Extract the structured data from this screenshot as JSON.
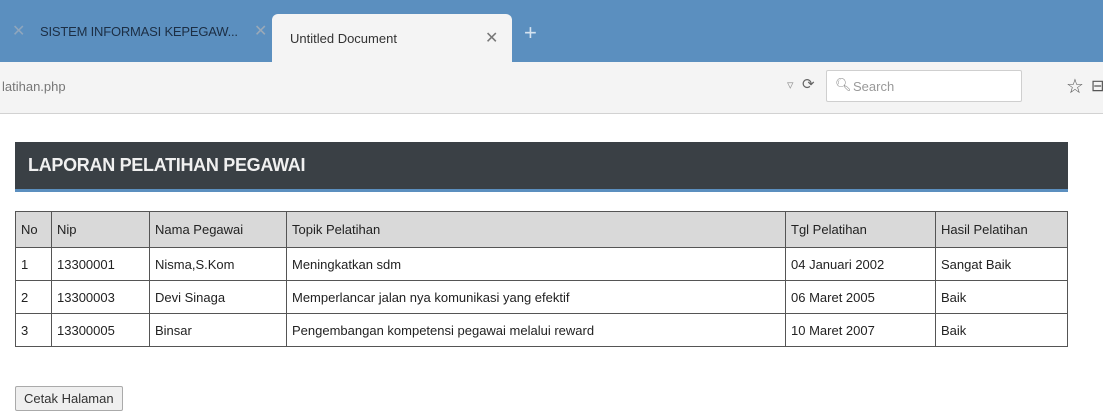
{
  "browser": {
    "tabs": [
      {
        "title": "SISTEM INFORMASI KEPEGAW...",
        "active": false
      },
      {
        "title": "Untitled Document",
        "active": true
      }
    ],
    "new_tab_icon": "plus-icon",
    "url": "latihan.php",
    "search_placeholder": "Search"
  },
  "page": {
    "title": "LAPORAN PELATIHAN PEGAWAI",
    "header_color": "#3a4045",
    "accent_color": "#5b8fbf",
    "table": {
      "columns": [
        "No",
        "Nip",
        "Nama Pegawai",
        "Topik Pelatihan",
        "Tgl Pelatihan",
        "Hasil Pelatihan"
      ],
      "rows": [
        [
          "1",
          "13300001",
          "Nisma,S.Kom",
          "Meningkatkan sdm",
          "04 Januari 2002",
          "Sangat Baik"
        ],
        [
          "2",
          "13300003",
          "Devi Sinaga",
          "Memperlancar jalan nya komunikasi yang efektif",
          "06 Maret 2005",
          "Baik"
        ],
        [
          "3",
          "13300005",
          "Binsar",
          "Pengembangan kompetensi pegawai melalui reward",
          "10 Maret 2007",
          "Baik"
        ]
      ]
    },
    "print_button": "Cetak Halaman"
  }
}
